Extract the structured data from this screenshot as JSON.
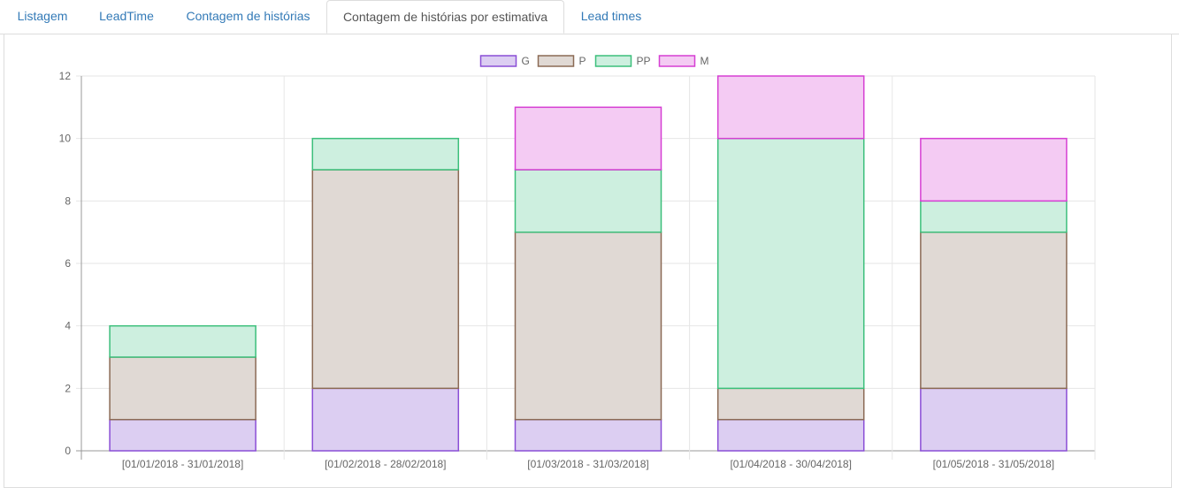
{
  "tabs": [
    {
      "label": "Listagem",
      "active": false
    },
    {
      "label": "LeadTime",
      "active": false
    },
    {
      "label": "Contagem de histórias",
      "active": false
    },
    {
      "label": "Contagem de histórias por estimativa",
      "active": true
    },
    {
      "label": "Lead times",
      "active": false
    }
  ],
  "chart_data": {
    "type": "bar",
    "stacked": true,
    "title": "",
    "xlabel": "",
    "ylabel": "",
    "categories": [
      "[01/01/2018 - 31/01/2018]",
      "[01/02/2018 - 28/02/2018]",
      "[01/03/2018 - 31/03/2018]",
      "[01/04/2018 - 30/04/2018]",
      "[01/05/2018 - 31/05/2018]"
    ],
    "series": [
      {
        "name": "G",
        "values": [
          1,
          2,
          1,
          1,
          2
        ],
        "fill": "#dccef2",
        "stroke": "#8a4ed6"
      },
      {
        "name": "P",
        "values": [
          2,
          7,
          6,
          1,
          5
        ],
        "fill": "#e0d9d4",
        "stroke": "#8b6a55"
      },
      {
        "name": "PP",
        "values": [
          1,
          1,
          2,
          8,
          1
        ],
        "fill": "#cdefdf",
        "stroke": "#3cbf7b"
      },
      {
        "name": "M",
        "values": [
          0,
          0,
          2,
          2,
          2
        ],
        "fill": "#f4cbf3",
        "stroke": "#d63fd3"
      }
    ],
    "ylim": [
      0,
      12
    ],
    "yticks": [
      0,
      2,
      4,
      6,
      8,
      10,
      12
    ],
    "grid": true,
    "legend": "top-center"
  }
}
